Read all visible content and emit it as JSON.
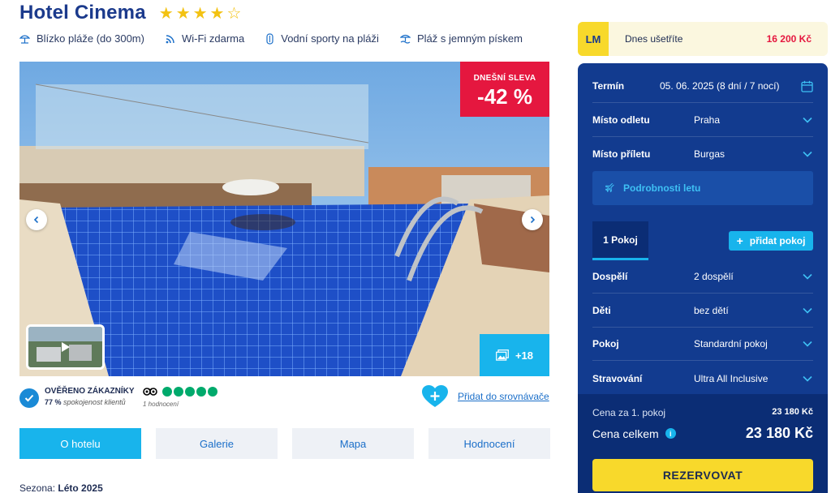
{
  "hotel": {
    "name": "Hotel Cinema",
    "stars_filled": "★★★★",
    "stars_empty": "☆",
    "rating_stars": 4
  },
  "amenities": [
    {
      "label": "Blízko pláže (do 300m)",
      "icon": "beach-umbrella-icon"
    },
    {
      "label": "Wi-Fi zdarma",
      "icon": "wifi-icon"
    },
    {
      "label": "Vodní sporty na pláži",
      "icon": "water-sports-icon"
    },
    {
      "label": "Pláž s jemným pískem",
      "icon": "sand-beach-icon"
    }
  ],
  "gallery": {
    "discount_label": "DNEŠNÍ SLEVA",
    "discount_value": "-42 %",
    "more_photos": "+18"
  },
  "verified": {
    "title": "OVĚŘENO ZÁKAZNÍKY",
    "percent": "77 %",
    "satisfaction": "spokojenost klientů"
  },
  "tripadvisor": {
    "bubbles": 5,
    "count": "1 hodnocení"
  },
  "compare": {
    "label": "Přidat do srovnávače"
  },
  "tabs": [
    {
      "label": "O hotelu",
      "active": true
    },
    {
      "label": "Galerie",
      "active": false
    },
    {
      "label": "Mapa",
      "active": false
    },
    {
      "label": "Hodnocení",
      "active": false
    }
  ],
  "season": {
    "label": "Sezona:",
    "value": "Léto 2025"
  },
  "savings": {
    "badge": "LM",
    "label": "Dnes ušetříte",
    "amount": "16 200 Kč"
  },
  "booking": {
    "term_label": "Termín",
    "term_value": "05. 06. 2025 (8 dní / 7 nocí)",
    "departure_label": "Místo odletu",
    "departure_value": "Praha",
    "arrival_label": "Místo příletu",
    "arrival_value": "Burgas",
    "flight_details": "Podrobnosti letu",
    "room_tab": "1 Pokoj",
    "add_room": "přidat pokoj",
    "adults_label": "Dospělí",
    "adults_value": "2 dospělí",
    "children_label": "Děti",
    "children_value": "bez dětí",
    "room_label": "Pokoj",
    "room_value": "Standardní pokoj",
    "board_label": "Stravování",
    "board_value": "Ultra All Inclusive"
  },
  "price": {
    "per_room_label": "Cena za 1. pokoj",
    "per_room_value": "23 180 Kč",
    "total_label": "Cena celkem",
    "total_value": "23 180 Kč",
    "reserve_label": "REZERVOVAT"
  },
  "colors": {
    "brand_navy": "#123b8f",
    "accent_cyan": "#18b4ec",
    "accent_yellow": "#f8d92b",
    "discount_red": "#e5173f",
    "tripadvisor_green": "#00aa6c"
  }
}
